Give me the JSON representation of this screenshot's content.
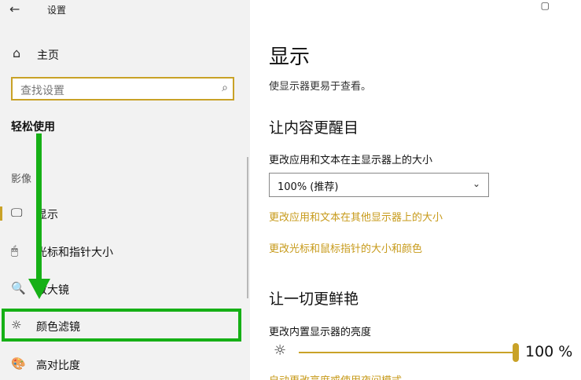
{
  "window": {
    "back_icon": "←",
    "title": "设置",
    "maximize_icon": "▢"
  },
  "sidebar": {
    "home_icon": "⌂",
    "home_label": "主页",
    "search_placeholder": "查找设置",
    "search_icon": "⌕",
    "section_title": "轻松使用",
    "category_title": "影像",
    "items": [
      {
        "icon": "🖵",
        "label": "显示",
        "selected": true
      },
      {
        "icon": "🖱",
        "label": "光标和指针大小",
        "selected": false
      },
      {
        "icon": "🔍",
        "label": "放大镜",
        "selected": false
      },
      {
        "icon": "☼",
        "label": "颜色滤镜",
        "selected": false
      },
      {
        "icon": "🎨",
        "label": "高对比度",
        "selected": false
      }
    ]
  },
  "main": {
    "title": "显示",
    "subtitle": "使显示器更易于查看。",
    "section1": {
      "heading": "让内容更醒目",
      "size_label": "更改应用和文本在主显示器上的大小",
      "size_value": "100% (推荐)",
      "dropdown_icon": "⌄",
      "link1": "更改应用和文本在其他显示器上的大小",
      "link2": "更改光标和鼠标指针的大小和颜色"
    },
    "section2": {
      "heading": "让一切更鲜艳",
      "brightness_label": "更改内置显示器的亮度",
      "brightness_icon": "☼",
      "brightness_value": "100 %",
      "brightness_fraction": 1.0,
      "cut_link": "自动更改亮度或使用夜间模式"
    }
  },
  "annotation": {
    "highlight_color": "#16b016",
    "accent_color": "#c9a227"
  }
}
